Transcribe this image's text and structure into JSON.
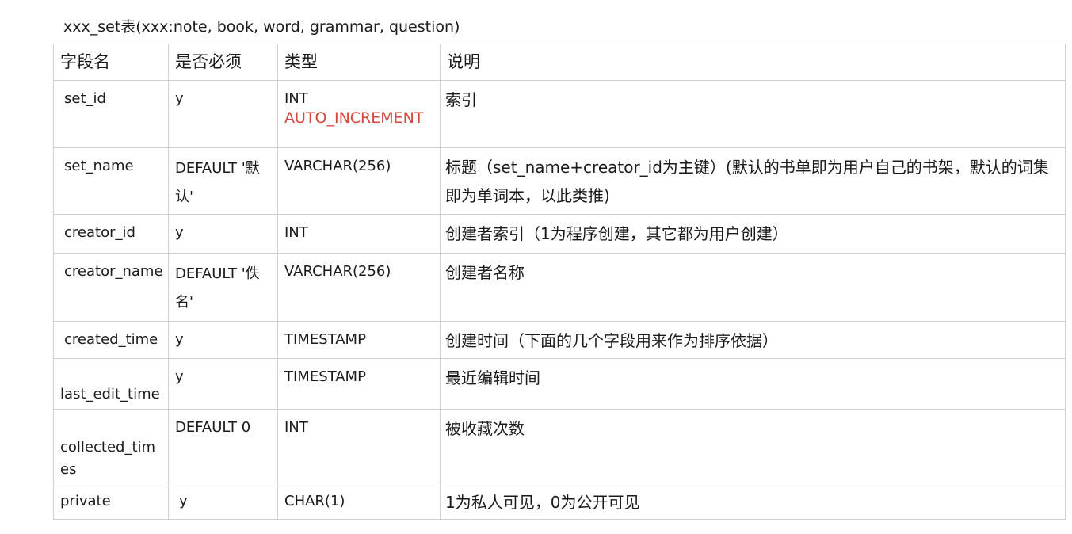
{
  "title": "xxx_set表(xxx:note, book, word, grammar, question)",
  "headers": [
    "字段名",
    "是否必须",
    "类型",
    "说明"
  ],
  "rows": [
    {
      "field": "set_id",
      "required": "y",
      "type": "INT",
      "type_extra": "AUTO_INCREMENT",
      "desc": "索引"
    },
    {
      "field": "set_name",
      "required": "DEFAULT '默认'",
      "type": "VARCHAR(256)",
      "desc": "标题（set_name+creator_id为主键）(默认的书单即为用户自己的书架，默认的词集即为单词本，以此类推)"
    },
    {
      "field": "creator_id",
      "required": "y",
      "type": "INT",
      "desc": "创建者索引（1为程序创建，其它都为用户创建）"
    },
    {
      "field": "creator_name",
      "required": "DEFAULT '佚名'",
      "type": "VARCHAR(256)",
      "desc": "创建者名称"
    },
    {
      "field": "created_time",
      "required": "y",
      "type": "TIMESTAMP",
      "desc": "创建时间（下面的几个字段用来作为排序依据）"
    },
    {
      "field": "last_edit_time",
      "required": "y",
      "type": "TIMESTAMP",
      "desc": "最近编辑时间"
    },
    {
      "field": "collected_times",
      "required": "DEFAULT 0",
      "type": "INT",
      "desc": "被收藏次数"
    },
    {
      "field": "private",
      "required": "y",
      "type": "CHAR(1)",
      "desc": "1为私人可见，0为公开可见"
    }
  ]
}
